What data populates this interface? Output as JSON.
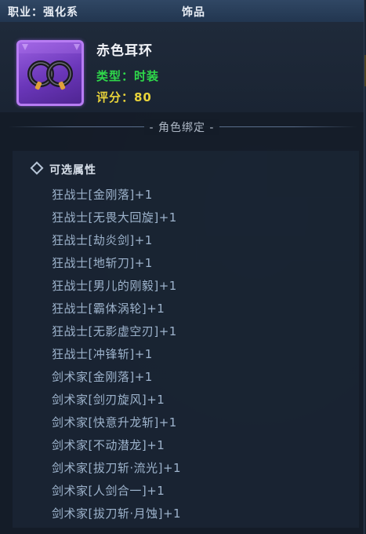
{
  "header": {
    "job": "职业：强化系",
    "category": "饰品"
  },
  "item": {
    "icon": "black-earring-icon",
    "name": "赤色耳环",
    "type": "类型：时装",
    "score": "评分：80",
    "bind": "- 角色绑定 -"
  },
  "section": {
    "title": "可选属性"
  },
  "attributes": [
    "狂战士[金刚落]+1",
    "狂战士[无畏大回旋]+1",
    "狂战士[劫炎剑]+1",
    "狂战士[地斩刀]+1",
    "狂战士[男儿的刚毅]+1",
    "狂战士[霸体涡轮]+1",
    "狂战士[无影虚空刃]+1",
    "狂战士[冲锋斩]+1",
    "剑术家[金刚落]+1",
    "剑术家[剑刃旋风]+1",
    "剑术家[快意升龙斩]+1",
    "剑术家[不动潜龙]+1",
    "剑术家[拔刀斩·流光]+1",
    "剑术家[人剑合一]+1",
    "剑术家[拔刀斩·月蚀]+1"
  ],
  "colors": {
    "type_green": "#2fd84a",
    "score_yellow": "#e8d33a",
    "rarity_purple": "#9a5fe0",
    "attr_blue": "#9db3cc"
  }
}
